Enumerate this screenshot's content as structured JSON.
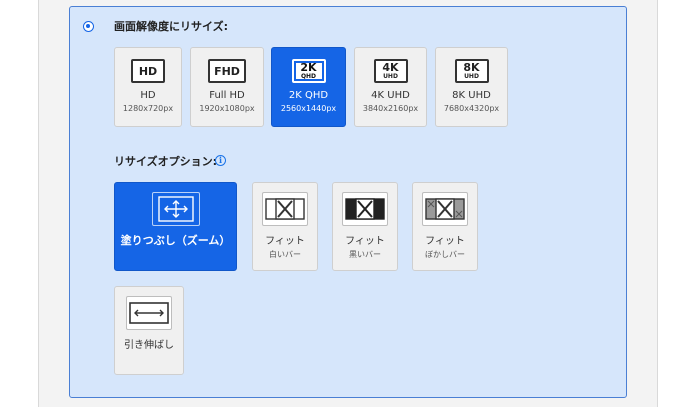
{
  "header": {
    "title": "画面解像度にリサイズ:",
    "selected": true
  },
  "resolutions": [
    {
      "badge_main": "HD",
      "badge_sub": "",
      "label": "HD",
      "size": "1280x720px",
      "selected": false
    },
    {
      "badge_main": "FHD",
      "badge_sub": "",
      "label": "Full HD",
      "size": "1920x1080px",
      "selected": false
    },
    {
      "badge_main": "2K",
      "badge_sub": "QHD",
      "label": "2K QHD",
      "size": "2560x1440px",
      "selected": true
    },
    {
      "badge_main": "4K",
      "badge_sub": "UHD",
      "label": "4K UHD",
      "size": "3840x2160px",
      "selected": false
    },
    {
      "badge_main": "8K",
      "badge_sub": "UHD",
      "label": "8K UHD",
      "size": "7680x4320px",
      "selected": false
    }
  ],
  "resize_options": {
    "title": "リサイズオプション:",
    "info_icon": "i",
    "items": [
      {
        "label": "塗りつぶし（ズーム）",
        "sub": "",
        "icon": "fill-zoom-icon",
        "selected": true
      },
      {
        "label": "フィット",
        "sub": "白いバー",
        "icon": "fit-white-bars-icon",
        "selected": false
      },
      {
        "label": "フィット",
        "sub": "黒いバー",
        "icon": "fit-black-bars-icon",
        "selected": false
      },
      {
        "label": "フィット",
        "sub": "ぼかしバー",
        "icon": "fit-blur-bars-icon",
        "selected": false
      },
      {
        "label": "引き伸ばし",
        "sub": "",
        "icon": "stretch-icon",
        "selected": false
      }
    ]
  },
  "colors": {
    "accent": "#1565e6",
    "panel_bg": "#d6e6fb",
    "panel_border": "#4a7fd4",
    "card_bg": "#f0f0f0"
  }
}
